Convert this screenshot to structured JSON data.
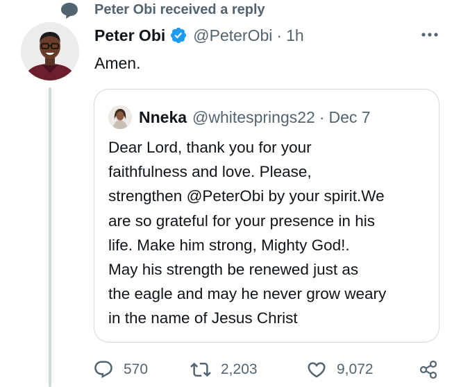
{
  "social_context": {
    "icon": "speech-bubble-icon",
    "text": "Peter Obi received a reply"
  },
  "tweet": {
    "author_name": "Peter Obi",
    "verified": true,
    "author_handle": "@PeterObi",
    "separator": "·",
    "timestamp": "1h",
    "text": "Amen.",
    "more_icon": "more-horizontal-icon"
  },
  "quoted_tweet": {
    "author_name": "Nneka",
    "author_handle": "@whitesprings22",
    "separator": "·",
    "date": "Dec 7",
    "text_lines": [
      "Dear Lord, thank you for your",
      "faithfulness and love. Please,",
      "strengthen @PeterObi by your spirit.We",
      "are so grateful for your presence in his",
      "life. Make him strong, Mighty God!.",
      "May his strength be renewed just as",
      "the eagle and may he never grow weary",
      "in the name of Jesus Christ"
    ]
  },
  "actions": {
    "reply": {
      "icon": "reply-icon",
      "count": "570"
    },
    "retweet": {
      "icon": "retweet-icon",
      "count": "2,203"
    },
    "like": {
      "icon": "heart-icon",
      "count": "9,072"
    },
    "share": {
      "icon": "share-icon"
    }
  },
  "colors": {
    "text_primary": "#0f1419",
    "text_secondary": "#536471",
    "border": "#cfd9de",
    "verified_blue": "#1d9bf0"
  }
}
